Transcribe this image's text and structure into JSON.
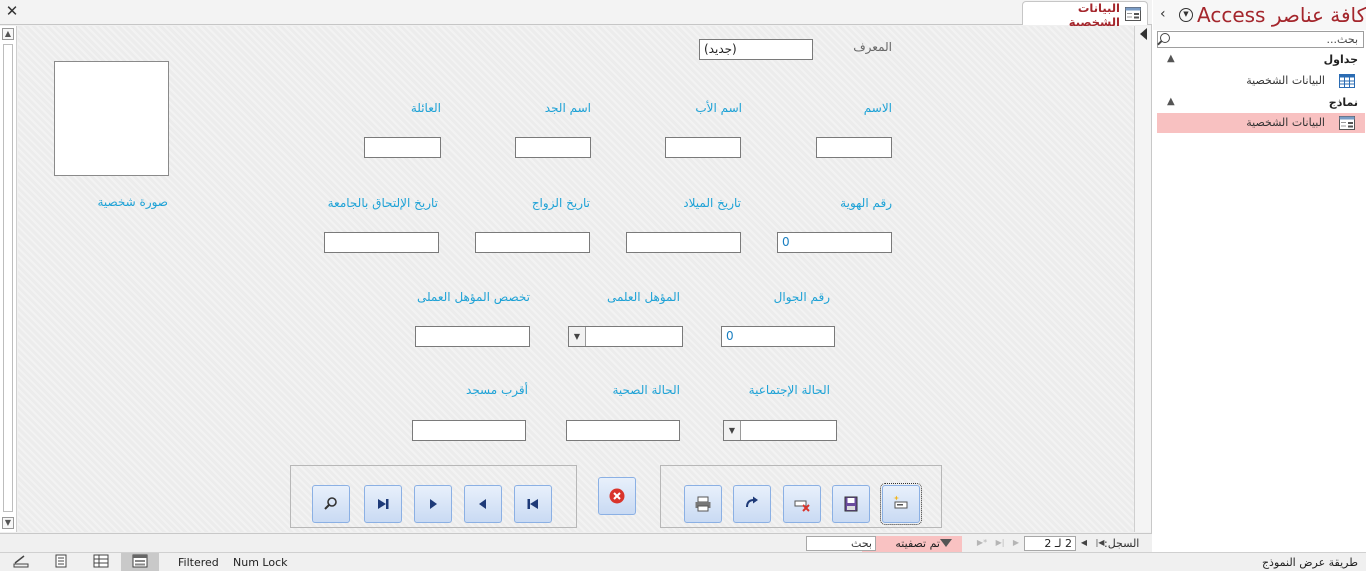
{
  "document": {
    "tab_title": "البيانات الشخصية",
    "close_symbol": "✕"
  },
  "form": {
    "id_label": "المعرف",
    "id_value": "(جديد)",
    "labels": {
      "name": "الاسم",
      "father_name": "اسم الأب",
      "grandfather_name": "اسم الجد",
      "family": "العائلة",
      "id_number": "رقم الهوية",
      "birth_date": "تاريخ الميلاد",
      "marriage_date": "تاريخ الزواج",
      "university_join_date": "تاريخ الإلتحاق بالجامعة",
      "photo": "صورة شخصية",
      "mobile": "رقم الجوال",
      "qualification": "المؤهل العلمى",
      "practical_specialty": "تخصص المؤهل العملى",
      "marital_status": "الحالة الإجتماعية",
      "health_status": "الحالة الصحية",
      "nearest_mosque": "أقرب مسجد"
    },
    "values": {
      "name": "",
      "father_name": "",
      "grandfather_name": "",
      "family": "",
      "id_number": "0",
      "birth_date": "",
      "marriage_date": "",
      "university_join_date": "",
      "mobile": "0",
      "qualification": "",
      "practical_specialty": "",
      "marital_status": "",
      "health_status": "",
      "nearest_mosque": ""
    },
    "nav_buttons": [
      "first-record",
      "previous-record",
      "next-record",
      "last-record",
      "find-record"
    ],
    "action_buttons": [
      "new-record",
      "save-record",
      "delete-record",
      "redo",
      "print-record"
    ],
    "close_button": "close-form"
  },
  "record_nav": {
    "label": "السجل:",
    "position": "2 لـ 2",
    "filter_status": "تم تصفيته",
    "search_placeholder": "بحث"
  },
  "nav_pane": {
    "title": "كافة عناصر Access",
    "search_placeholder": "بحث...",
    "groups": [
      {
        "label": "جداول",
        "items": [
          {
            "label": "البيانات الشخصية",
            "icon": "table-icon",
            "selected": false
          }
        ]
      },
      {
        "label": "نماذج",
        "items": [
          {
            "label": "البيانات الشخصية",
            "icon": "form-icon",
            "selected": true
          }
        ]
      }
    ]
  },
  "status_bar": {
    "filtered": "Filtered",
    "num_lock": "Num Lock",
    "view_name": "طريقة عرض النموذج"
  },
  "colors": {
    "label_blue": "#1ea2d6",
    "title_red": "#a4262c",
    "selected_bg": "#f8c1c1"
  }
}
